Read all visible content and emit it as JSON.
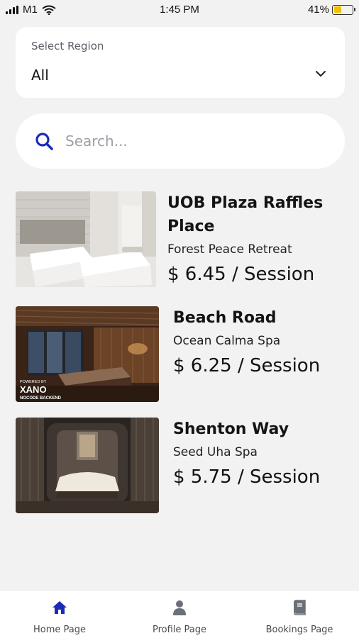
{
  "status_bar": {
    "carrier": "M1",
    "time": "1:45 PM",
    "battery_percent_label": "41%",
    "battery_level": 0.41
  },
  "region_select": {
    "label": "Select Region",
    "selected": "All"
  },
  "search": {
    "placeholder": "Search..."
  },
  "listings": [
    {
      "location": "UOB Plaza Raffles Place",
      "location_line1": "UOB Plaza Raffles",
      "location_line2": "Place",
      "spa": "Forest Peace Retreat",
      "price": "$ 6.45 / Session"
    },
    {
      "location": "Beach Road",
      "spa": "Ocean Calma Spa",
      "price": "$ 6.25 / Session",
      "watermark_powered": "POWERED BY",
      "watermark_brand": "XANO",
      "watermark_tag": "NOCODE BACKEND"
    },
    {
      "location": "Shenton Way",
      "spa": "Seed Uha Spa",
      "price": "$ 5.75 / Session"
    }
  ],
  "bottom_nav": {
    "items": [
      {
        "label": "Home Page",
        "icon": "home-icon",
        "active": true
      },
      {
        "label": "Profile Page",
        "icon": "person-icon",
        "active": false
      },
      {
        "label": "Bookings Page",
        "icon": "book-icon",
        "active": false
      }
    ]
  },
  "colors": {
    "accent": "#1a2bb8",
    "background": "#f2f2f2",
    "inactive_icon": "#6b6f78"
  }
}
